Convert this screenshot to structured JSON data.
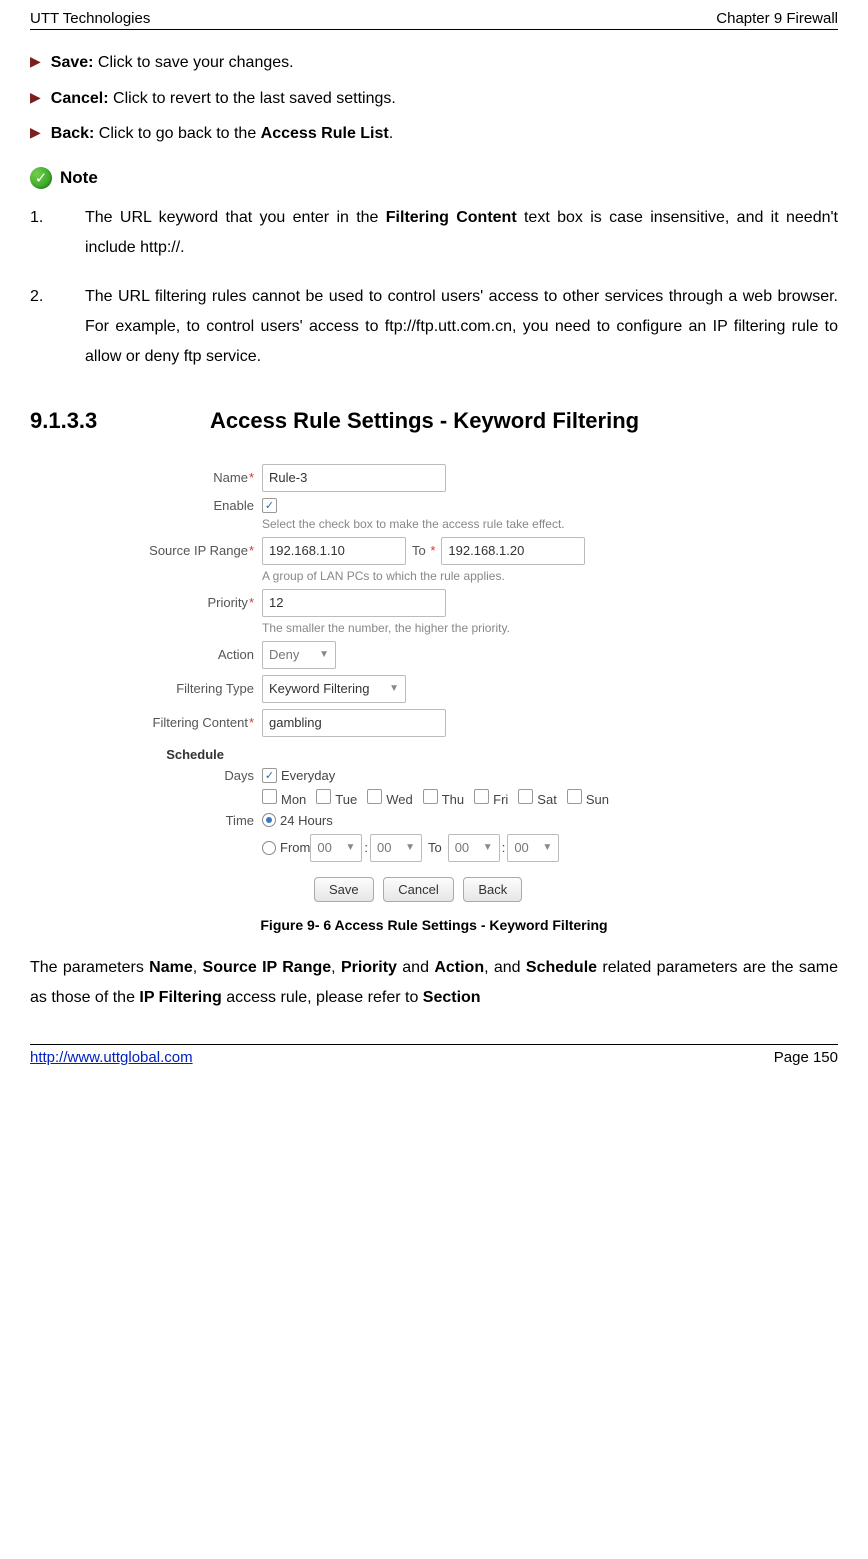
{
  "header": {
    "left": "UTT Technologies",
    "right": "Chapter 9 Firewall"
  },
  "bullets": {
    "save": {
      "bold": "Save:",
      "rest": " Click to save your changes."
    },
    "cancel": {
      "bold": "Cancel:",
      "rest": " Click to revert to the last saved settings."
    },
    "back": {
      "bold": "Back:",
      "rest1": " Click to go back to the ",
      "bold2": "Access Rule List",
      "rest2": "."
    }
  },
  "note": {
    "label": "Note"
  },
  "list": {
    "i1": {
      "num": "1.",
      "t1": "The URL keyword that you enter in the ",
      "b1": "Filtering Content",
      "t2": " text box is case insensitive, and it needn't include http://."
    },
    "i2": {
      "num": "2.",
      "t1": "The URL filtering rules cannot be used to control users' access to other services through a web browser. For example, to control users' access to ftp://ftp.utt.com.cn, you need to configure an IP filtering rule to allow or deny ftp service."
    }
  },
  "section": {
    "num": "9.1.3.3",
    "title": "Access Rule Settings - Keyword Filtering"
  },
  "form": {
    "labels": {
      "name": "Name",
      "enable": "Enable",
      "srcip": "Source IP Range",
      "to": "To",
      "priority": "Priority",
      "action": "Action",
      "ftype": "Filtering Type",
      "fcontent": "Filtering Content",
      "schedule": "Schedule",
      "days": "Days",
      "time": "Time",
      "from": "From",
      "to2": "To"
    },
    "values": {
      "name": "Rule-3",
      "srcip_from": "192.168.1.10",
      "srcip_to": "192.168.1.20",
      "priority": "12",
      "action": "Deny",
      "ftype": "Keyword Filtering",
      "fcontent": "gambling"
    },
    "hints": {
      "enable": "Select the check box to make the access rule take effect.",
      "srcip": "A group of LAN PCs to which the rule applies.",
      "priority": "The smaller the number, the higher the priority."
    },
    "days": {
      "everyday": "Everyday",
      "list": [
        "Mon",
        "Tue",
        "Wed",
        "Thu",
        "Fri",
        "Sat",
        "Sun"
      ]
    },
    "time": {
      "h24": "24 Hours",
      "hh": "00",
      "mm": "00"
    },
    "buttons": {
      "save": "Save",
      "cancel": "Cancel",
      "back": "Back"
    }
  },
  "figcap": "Figure 9- 6 Access Rule Settings - Keyword Filtering",
  "para2": {
    "t1": "The parameters ",
    "b1": "Name",
    "c1": ", ",
    "b2": "Source IP Range",
    "c2": ", ",
    "b3": "Priority",
    "c3": " and ",
    "b4": "Action",
    "c4": ", and ",
    "b5": "Schedule",
    "c5": " related parameters are the same as those of the ",
    "b6": "IP Filtering",
    "c6": " access rule, please refer to ",
    "b7": "Section"
  },
  "footer": {
    "url": "http://www.uttglobal.com",
    "page": "Page 150"
  }
}
